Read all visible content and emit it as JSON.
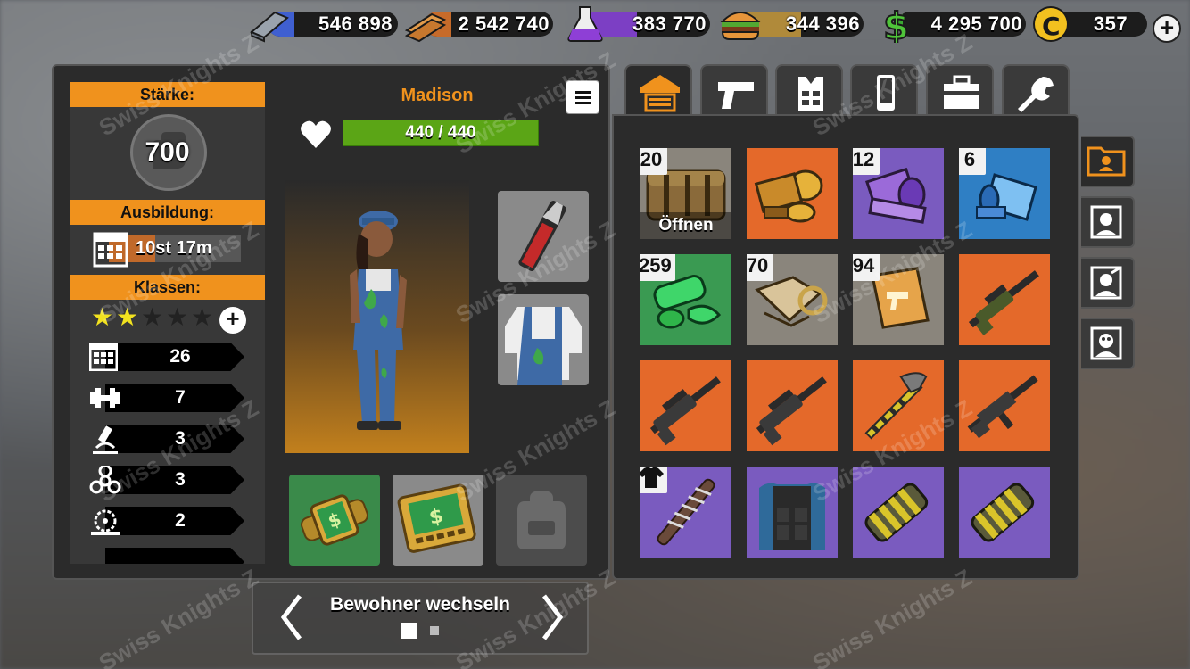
{
  "resources": {
    "steel": "546 898",
    "wood": "2 542 740",
    "chemicals": "383 770",
    "food": "344 396",
    "cash": "4 295 700",
    "caps": "357"
  },
  "stats": {
    "strength_label": "Stärke:",
    "strength_value": "700",
    "training_label": "Ausbildung:",
    "training_time": "10st 17m",
    "training_progress": 0.35,
    "classes_label": "Klassen:",
    "stars_filled": 2,
    "stars_total": 5,
    "skills": [
      {
        "icon": "calculator-icon",
        "value": "26"
      },
      {
        "icon": "dumbbell-icon",
        "value": "7"
      },
      {
        "icon": "microscope-icon",
        "value": "3"
      },
      {
        "icon": "biohazard-icon",
        "value": "3"
      },
      {
        "icon": "saw-icon",
        "value": "2"
      }
    ]
  },
  "character": {
    "name": "Madison",
    "hp": "440 / 440"
  },
  "inventory": {
    "items": [
      {
        "count": "20",
        "label": "Öffnen",
        "color": "gray",
        "icon": "crate-icon"
      },
      {
        "count": "",
        "color": "orange",
        "icon": "scrap-parts-icon"
      },
      {
        "count": "12",
        "color": "purple",
        "icon": "purple-parts-icon"
      },
      {
        "count": "6",
        "color": "blue",
        "icon": "blue-parts-icon"
      },
      {
        "count": "259",
        "color": "green",
        "icon": "green-parts-icon"
      },
      {
        "count": "70",
        "color": "gray",
        "icon": "cloth-parts-icon"
      },
      {
        "count": "94",
        "color": "gray",
        "icon": "weapon-badge-icon"
      },
      {
        "count": "",
        "color": "orange",
        "icon": "sniper-rifle-icon"
      },
      {
        "count": "",
        "color": "orange",
        "icon": "scoped-rifle-icon"
      },
      {
        "count": "",
        "color": "orange",
        "icon": "scoped-rifle-icon"
      },
      {
        "count": "",
        "color": "orange",
        "icon": "axe-icon"
      },
      {
        "count": "",
        "color": "orange",
        "icon": "assault-rifle-icon"
      },
      {
        "count": "",
        "color": "purple",
        "icon": "barbed-bat-icon"
      },
      {
        "count": "",
        "color": "purple",
        "icon": "armor-vest-icon"
      },
      {
        "count": "",
        "color": "purple",
        "icon": "gauntlet-icon"
      },
      {
        "count": "",
        "color": "purple",
        "icon": "gauntlet-icon"
      }
    ]
  },
  "switcher": {
    "label": "Bewohner wechseln"
  },
  "watermark": "Swiss Knights Z"
}
